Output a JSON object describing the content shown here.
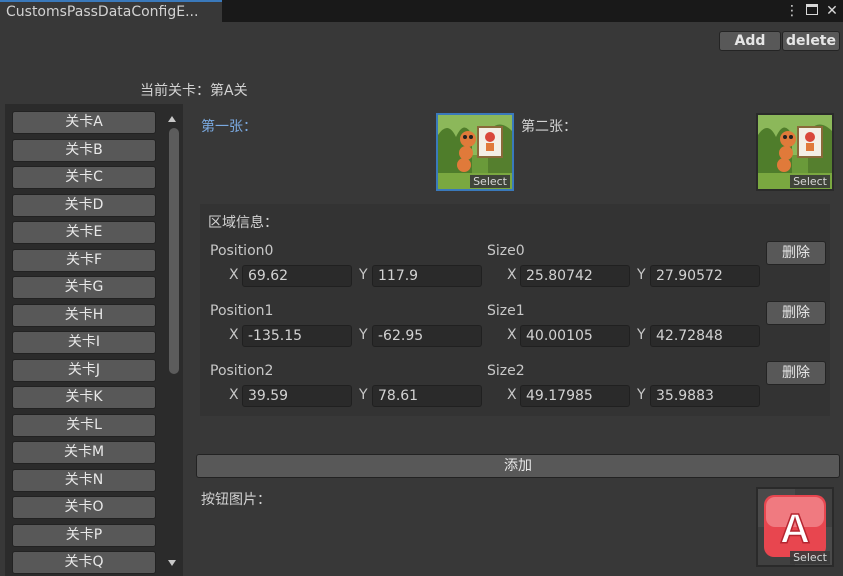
{
  "window": {
    "tab_title": "CustomsPassDataConfigE..."
  },
  "toolbar": {
    "add_label": "Add",
    "delete_label": "delete"
  },
  "current_level": "当前关卡：第A关",
  "levels": [
    "关卡A",
    "关卡B",
    "关卡C",
    "关卡D",
    "关卡E",
    "关卡F",
    "关卡G",
    "关卡H",
    "关卡I",
    "关卡J",
    "关卡K",
    "关卡L",
    "关卡M",
    "关卡N",
    "关卡O",
    "关卡P",
    "关卡Q"
  ],
  "images": {
    "first_label": "第一张：",
    "second_label": "第二张：",
    "select_label": "Select"
  },
  "region": {
    "title": "区域信息：",
    "x_axis": "X",
    "y_axis": "Y",
    "delete_label": "删除",
    "entries": [
      {
        "position_label": "Position0",
        "pos_x": "69.62",
        "pos_y": "117.9",
        "size_label": "Size0",
        "size_x": "25.80742",
        "size_y": "27.90572"
      },
      {
        "position_label": "Position1",
        "pos_x": "-135.15",
        "pos_y": "-62.95",
        "size_label": "Size1",
        "size_x": "40.00105",
        "size_y": "42.72848"
      },
      {
        "position_label": "Position2",
        "pos_x": "39.59",
        "pos_y": "78.61",
        "size_label": "Size2",
        "size_x": "49.17985",
        "size_y": "35.9883"
      }
    ]
  },
  "add_region_label": "添加",
  "button_image_label": "按钮图片：",
  "button_image_letter": "A",
  "colors": {
    "accent": "#3a79bb",
    "first_label": "#7aa9e0",
    "letter_button": "#e8464f"
  }
}
